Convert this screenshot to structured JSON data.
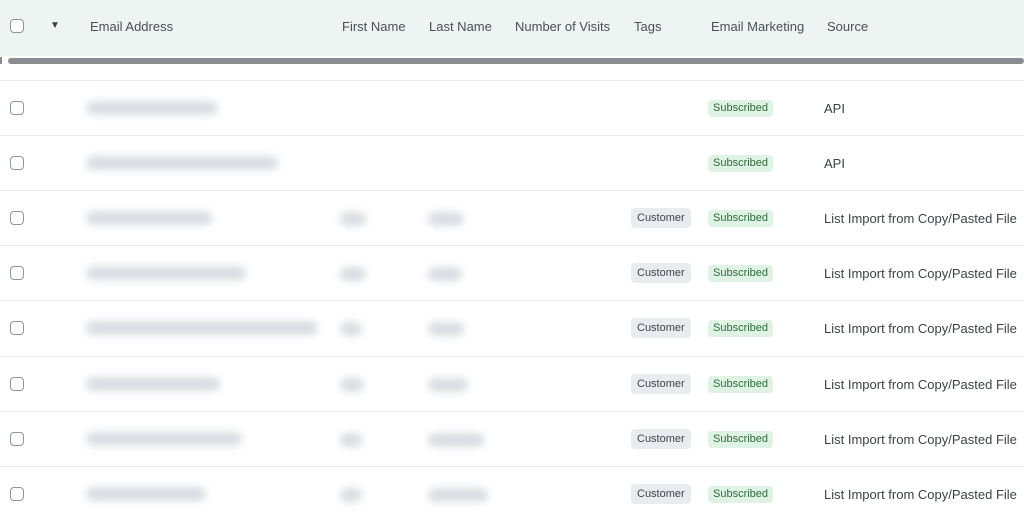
{
  "header": {
    "columns": {
      "email": "Email Address",
      "first_name": "First Name",
      "last_name": "Last Name",
      "visits": "Number of Visits",
      "tags": "Tags",
      "email_marketing": "Email Marketing",
      "source": "Source"
    }
  },
  "rows": [
    {
      "tag": "",
      "marketing": "Subscribed",
      "source": "API"
    },
    {
      "tag": "",
      "marketing": "Subscribed",
      "source": "API"
    },
    {
      "tag": "Customer",
      "marketing": "Subscribed",
      "source": "List Import from Copy/Pasted File"
    },
    {
      "tag": "Customer",
      "marketing": "Subscribed",
      "source": "List Import from Copy/Pasted File"
    },
    {
      "tag": "Customer",
      "marketing": "Subscribed",
      "source": "List Import from Copy/Pasted File"
    },
    {
      "tag": "Customer",
      "marketing": "Subscribed",
      "source": "List Import from Copy/Pasted File"
    },
    {
      "tag": "Customer",
      "marketing": "Subscribed",
      "source": "List Import from Copy/Pasted File"
    },
    {
      "tag": "Customer",
      "marketing": "Subscribed",
      "source": "List Import from Copy/Pasted File"
    }
  ],
  "icons": {
    "header_checkbox": "checkbox-icon",
    "column_menu": "chevron-down-icon"
  },
  "colors": {
    "header_bg": "#eef4f1",
    "subscribed_bg": "#dff3e4",
    "subscribed_text": "#2f6b3b",
    "tag_bg": "#e9ecef",
    "scrollbar": "#8a8d91"
  }
}
